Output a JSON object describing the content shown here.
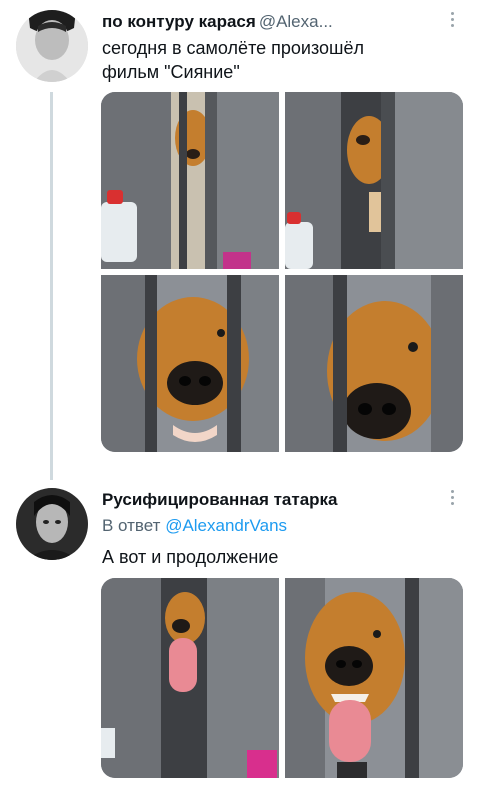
{
  "tweets": [
    {
      "author": {
        "name": "по контуру карася",
        "handle": "@Alexa..."
      },
      "text": "сегодня в самолёте произошёл фильм \"Сияние\"",
      "media": [
        {
          "icon": "dog-peeking-photo"
        },
        {
          "icon": "dog-peeking-photo"
        },
        {
          "icon": "dog-snout-photo"
        },
        {
          "icon": "dog-snout-photo"
        }
      ]
    },
    {
      "author": {
        "name": "Русифицированная татарка"
      },
      "reply_prefix": "В ответ",
      "reply_mention": "@AlexandrVans",
      "text": "А вот и продолжение",
      "media": [
        {
          "icon": "dog-tongue-photo"
        },
        {
          "icon": "dog-tongue-photo"
        }
      ]
    }
  ],
  "colors": {
    "text": "#0f1419",
    "secondary": "#536471",
    "link": "#1d9bf0",
    "thread_line": "#cfd9de",
    "dog_fur": "#c47e2e",
    "seat_gray": "#7a7d82"
  }
}
